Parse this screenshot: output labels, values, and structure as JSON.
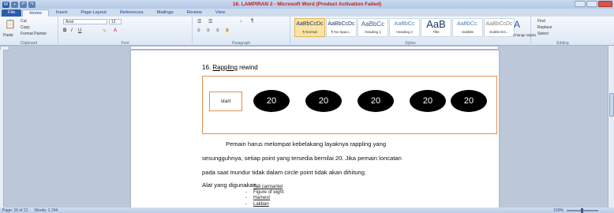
{
  "window": {
    "title": "16. LAMPIRAN 2 - Microsoft Word (Product Activation Failed)"
  },
  "tabs": [
    "File",
    "Home",
    "Insert",
    "Page Layout",
    "References",
    "Mailings",
    "Review",
    "View"
  ],
  "ribbon": {
    "clipboard": {
      "label": "Clipboard",
      "paste": "Paste",
      "cut": "Cut",
      "copy": "Copy",
      "format_painter": "Format Painter"
    },
    "font": {
      "label": "Font",
      "name": "Arial",
      "size": "12"
    },
    "paragraph": {
      "label": "Paragraph"
    },
    "styles": {
      "label": "Styles",
      "items": [
        {
          "preview": "AaBbCcDc",
          "name": "¶ Normal"
        },
        {
          "preview": "AaBbCcDc",
          "name": "¶ No Spaci..."
        },
        {
          "preview": "AaBbCc",
          "name": "Heading 1"
        },
        {
          "preview": "AaBbCc",
          "name": "Heading 2"
        },
        {
          "preview": "AaB",
          "name": "Title"
        },
        {
          "preview": "AaBbCc.",
          "name": "Subtitle"
        },
        {
          "preview": "AaBbCcDc",
          "name": "Subtle Em..."
        }
      ],
      "change_styles": "Change Styles"
    },
    "editing": {
      "label": "Editing",
      "find": "Find",
      "replace": "Replace",
      "select": "Select"
    }
  },
  "document": {
    "heading_number": "16.",
    "heading_word": "Rappling",
    "heading_rest": "rewind",
    "start_label": "start",
    "points": [
      "20",
      "20",
      "20",
      "20",
      "20"
    ],
    "paragraph": [
      "Pemain  harus  melompat  kebelakang  layaknya  rappling  yang",
      "sesungguhnya, setiap point yang tersedia bernilai 20. Jika pemain loncatan",
      "pada saat mundur tidak dalam circle point tidak akan dihitung."
    ],
    "tools_label": "Alat yang digunakan :",
    "tools": [
      "Tali carmantel",
      "Figure of eight",
      "Harnest",
      "Lakban"
    ]
  },
  "status": {
    "page": "Page: 16 of 21",
    "words": "Words: 1,744",
    "zoom": "100%"
  }
}
